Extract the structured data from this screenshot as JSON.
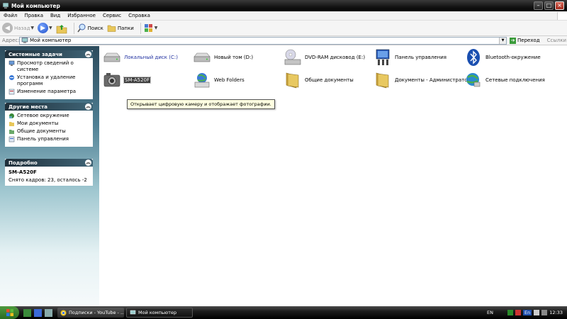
{
  "window": {
    "title": "Мой компьютер"
  },
  "menu": [
    "Файл",
    "Правка",
    "Вид",
    "Избранное",
    "Сервис",
    "Справка"
  ],
  "toolbar": {
    "back": "Назад",
    "search": "Поиск",
    "folders": "Папки"
  },
  "address": {
    "label": "Адрес:",
    "value": "Мой компьютер",
    "go": "Переход",
    "links": "Ссылки"
  },
  "left": {
    "system_tasks": {
      "title": "Системные задачи",
      "items": [
        "Просмотр сведений о системе",
        "Установка и удаление программ",
        "Изменение параметра"
      ]
    },
    "other_places": {
      "title": "Другие места",
      "items": [
        "Сетевое окружение",
        "Мои документы",
        "Общие документы",
        "Панель управления"
      ]
    },
    "details": {
      "title": "Подробно",
      "name": "SM-A520F",
      "info": "Снято кадров: 23, осталось -2"
    }
  },
  "items": [
    {
      "label": "Локальный диск (C:)",
      "icon": "drive-icon"
    },
    {
      "label": "Новый том (D:)",
      "icon": "drive-icon"
    },
    {
      "label": "DVD-RAM дисковод (E:)",
      "icon": "dvd-drive-icon"
    },
    {
      "label": "Панель управления",
      "icon": "control-panel-icon"
    },
    {
      "label": "Bluetooth-окружение",
      "icon": "bluetooth-icon"
    },
    {
      "label": "SM-A520F",
      "icon": "camera-icon"
    },
    {
      "label": "Web Folders",
      "icon": "web-folders-icon"
    },
    {
      "label": "Общие документы",
      "icon": "folder-icon"
    },
    {
      "label": "Документы - Администратор",
      "icon": "folder-icon"
    },
    {
      "label": "Сетевые подключения",
      "icon": "network-connections-icon"
    }
  ],
  "tooltip": "Открывает цифровую камеру и отображает фотографии.",
  "taskbar": {
    "tasks": [
      "Подписки - YouTube - ...",
      "Мой компьютер"
    ],
    "lang": "EN",
    "tray_lang": "En",
    "clock": "12:33"
  },
  "colors": {
    "link": "#2030a0",
    "panel_header": "#3f6476",
    "selection": "#3d3d3d"
  }
}
